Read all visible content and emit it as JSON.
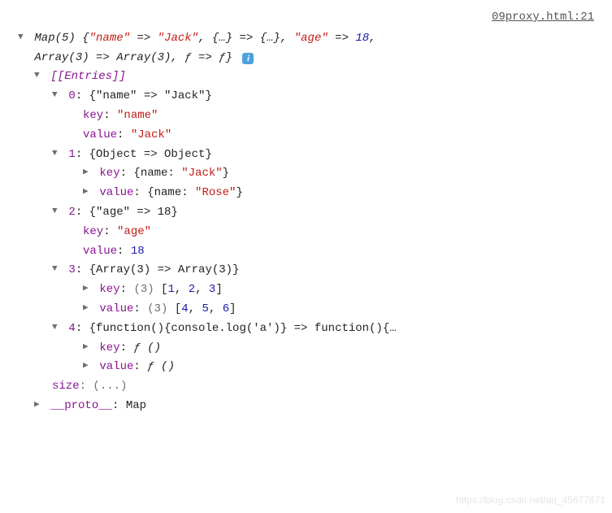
{
  "source": {
    "file": "09proxy.html",
    "line": "21"
  },
  "header": {
    "prefix": "Map(5) {",
    "pair0_key": "\"name\"",
    "pair0_arrow": " => ",
    "pair0_val": "\"Jack\"",
    "sep": ", ",
    "pair1_key": "{…}",
    "pair1_arrow": " => ",
    "pair1_val": "{…}",
    "pair2_key": "\"age\"",
    "pair2_arrow": " => ",
    "pair2_val": "18",
    "line2_prefix": "Array(3) => Array(3), ",
    "line2_f1": "ƒ",
    "line2_arrow": " => ",
    "line2_f2": "ƒ",
    "line2_suffix": "}"
  },
  "entries_label": "[[Entries]]",
  "e0": {
    "idx": "0",
    "summary": ": {\"name\" => \"Jack\"}",
    "key_label": "key",
    "key_val": "\"name\"",
    "value_label": "value",
    "value_val": "\"Jack\""
  },
  "e1": {
    "idx": "1",
    "summary": ": {Object => Object}",
    "key_label": "key",
    "key_pre": ": {name: ",
    "key_val": "\"Jack\"",
    "key_post": "}",
    "value_label": "value",
    "value_pre": ": {name: ",
    "value_val": "\"Rose\"",
    "value_post": "}"
  },
  "e2": {
    "idx": "2",
    "summary": ": {\"age\" => 18}",
    "key_label": "key",
    "key_val": "\"age\"",
    "value_label": "value",
    "value_val": "18"
  },
  "e3": {
    "idx": "3",
    "summary": ": {Array(3) => Array(3)}",
    "key_label": "key",
    "key_count": "(3)",
    "key_open": " [",
    "key_v1": "1",
    "key_v2": "2",
    "key_v3": "3",
    "key_close": "]",
    "value_label": "value",
    "value_count": "(3)",
    "value_open": " [",
    "value_v1": "4",
    "value_v2": "5",
    "value_v3": "6",
    "value_close": "]",
    "comma": ", "
  },
  "e4": {
    "idx": "4",
    "summary": ": {function(){console.log('a')} => function(){…",
    "key_label": "key",
    "key_val": "ƒ ()",
    "value_label": "value",
    "value_val": "ƒ ()"
  },
  "size": {
    "label": "size",
    "value": ": (...)"
  },
  "proto": {
    "label": "__proto__",
    "value": ": Map"
  },
  "colon": ": ",
  "watermark": "https://blog.csdn.net/qq_45677671"
}
